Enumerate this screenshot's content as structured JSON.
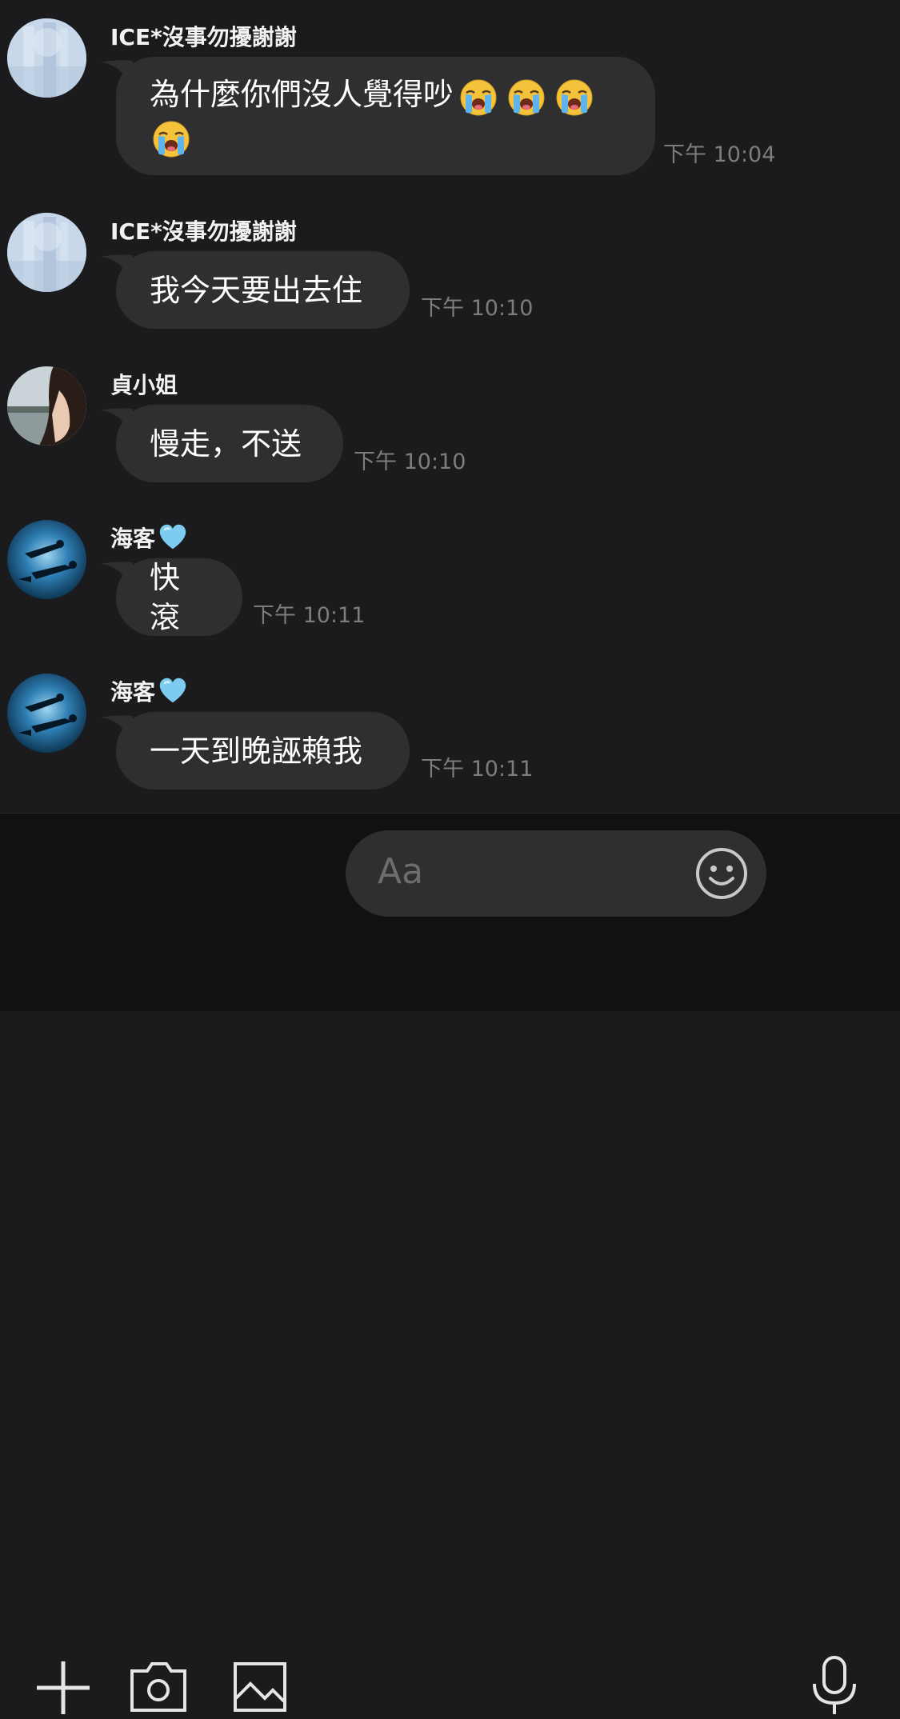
{
  "messages": [
    {
      "sender": "ICE*沒事勿擾謝謝",
      "text": "為什麼你們沒人覺得吵",
      "emoji_count": 4,
      "emoji_name": "loudly-crying-face",
      "time": "下午 10:04"
    },
    {
      "sender": "ICE*沒事勿擾謝謝",
      "text": "我今天要出去住",
      "time": "下午 10:10"
    },
    {
      "sender": "貞小姐",
      "text": "慢走，不送",
      "time": "下午 10:10"
    },
    {
      "sender": "海客",
      "sender_suffix_icon": "blue-heart",
      "text": "快滾",
      "time": "下午 10:11"
    },
    {
      "sender": "海客",
      "sender_suffix_icon": "blue-heart",
      "text": "一天到晚誣賴我",
      "time": "下午 10:11"
    }
  ],
  "input": {
    "placeholder": "Aa"
  },
  "toolbar": {
    "icons": [
      "plus-icon",
      "camera-icon",
      "image-icon",
      "smiley-icon",
      "microphone-icon"
    ]
  },
  "colors": {
    "background": "#1b1b1d",
    "bubble": "#2f2f31",
    "timestamp": "#7d7d80",
    "toolbar": "#111112",
    "heart": "#7ecbf0"
  }
}
